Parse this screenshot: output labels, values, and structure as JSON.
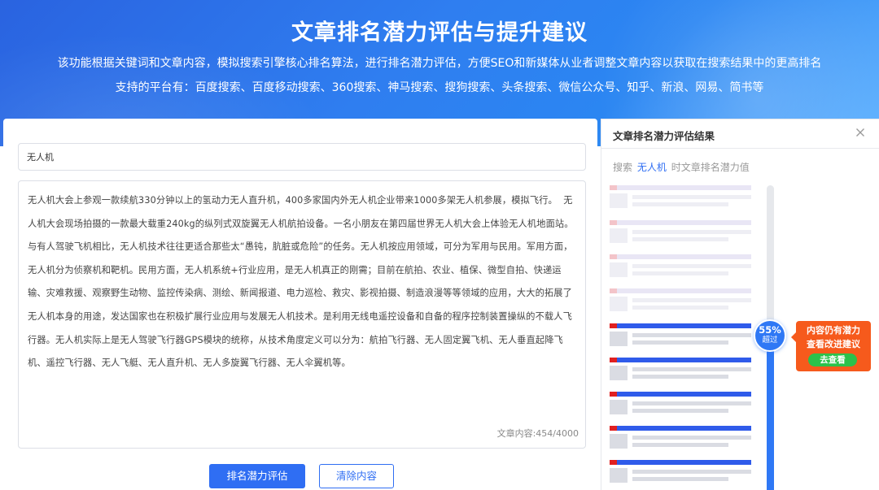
{
  "hero": {
    "title": "文章排名潜力评估与提升建议",
    "description": "该功能根据关键词和文章内容，模拟搜索引擎核心排名算法，进行排名潜力评估，方便SEO和新媒体从业者调整文章内容以获取在搜索结果中的更高排名",
    "platforms": "支持的平台有：百度搜索、百度移动搜索、360搜索、神马搜索、搜狗搜索、头条搜索、微信公众号、知乎、新浪、网易、简书等"
  },
  "form": {
    "keyword_value": "无人机",
    "content_value": "无人机大会上参观一款续航330分钟以上的氢动力无人直升机，400多家国内外无人机企业带来1000多架无人机参展，模拟飞行。  无人机大会现场拍摄的一款最大载重240kg的纵列式双旋翼无人机航拍设备。一名小朋友在第四届世界无人机大会上体验无人机地面站。与有人驾驶飞机相比，无人机技术往往更适合那些太“愚钝，肮脏或危险”的任务。无人机按应用领域，可分为军用与民用。军用方面，无人机分为侦察机和靶机。民用方面，无人机系统+行业应用，是无人机真正的刚需；目前在航拍、农业、植保、微型自拍、快递运输、灾难救援、观察野生动物、监控传染病、测绘、新闻报道、电力巡检、救灾、影视拍摄、制造浪漫等等领域的应用，大大的拓展了无人机本身的用途，发达国家也在积极扩展行业应用与发展无人机技术。是利用无线电遥控设备和自备的程序控制装置操纵的不载人飞行器。无人机实际上是无人驾驶飞行器GPS模块的统称，从技术角度定义可以分为：航拍飞行器、无人固定翼飞机、无人垂直起降飞机、遥控飞行器、无人飞艇、无人直升机、无人多旋翼飞行器、无人伞翼机等。",
    "char_count": "文章内容:454/4000",
    "evaluate_label": "排名潜力评估",
    "clear_label": "清除内容"
  },
  "result": {
    "title": "文章排名潜力评估结果",
    "sub_prefix": "搜索",
    "sub_keyword": "无人机",
    "sub_suffix": "时文章排名潜力值",
    "percent": "55%",
    "percent_label": "超过",
    "percent_value": 55,
    "tip_line1": "内容仍有潜力",
    "tip_line2": "查看改进建议",
    "tip_button": "去查看",
    "colors": {
      "accent": "#2f6ef3",
      "tip": "#f65a1c",
      "tip_button": "#2bc14b",
      "flag": "#e02020"
    }
  }
}
